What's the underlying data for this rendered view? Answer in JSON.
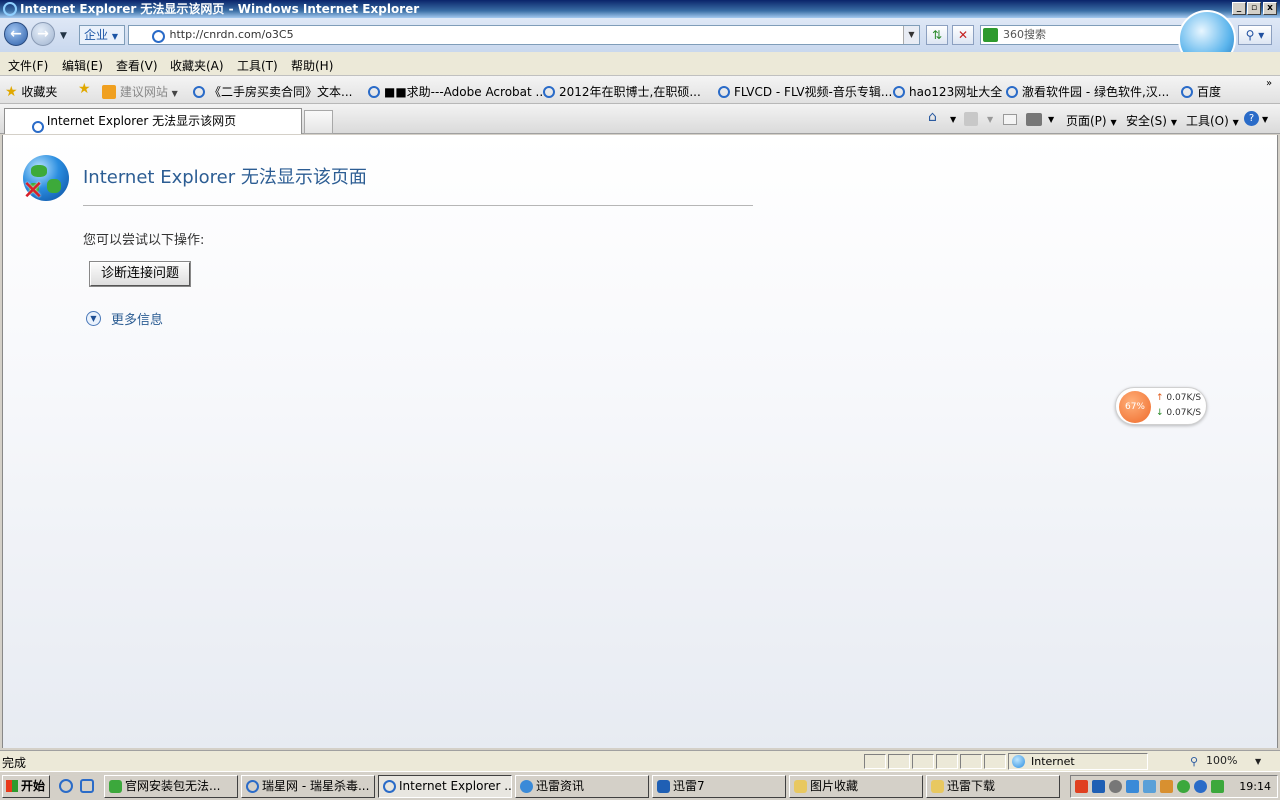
{
  "window": {
    "title": "Internet Explorer 无法显示该网页 - Windows Internet Explorer",
    "min": "_",
    "max": "▫",
    "close": "x"
  },
  "address": {
    "zone": "企业",
    "url": "http://cnrdn.com/o3C5",
    "search_placeholder": "360搜索"
  },
  "menu": [
    "文件(F)",
    "编辑(E)",
    "查看(V)",
    "收藏夹(A)",
    "工具(T)",
    "帮助(H)"
  ],
  "favorites": {
    "label": "收藏夹",
    "suggested": "建议网站",
    "items": [
      "《二手房买卖合同》文本...",
      "■■求助---Adobe Acrobat ...",
      "2012年在职博士,在职硕...",
      "FLVCD - FLV视频-音乐专辑...",
      "hao123网址大全",
      "澈看软件园 - 绿色软件,汉...",
      "百度"
    ]
  },
  "tab": {
    "title": "Internet Explorer 无法显示该网页"
  },
  "commands": {
    "page": "页面(P)",
    "safety": "安全(S)",
    "tools": "工具(O)"
  },
  "error": {
    "title": "Internet Explorer 无法显示该页面",
    "try_text": "您可以尝试以下操作:",
    "diagnose_button": "诊断连接问题",
    "more_info": "更多信息"
  },
  "speed_widget": {
    "percent": "67%",
    "up": "0.07K/S",
    "down": "0.07K/S"
  },
  "status": {
    "text": "完成",
    "zone": "Internet",
    "zoom": "100%"
  },
  "taskbar": {
    "start": "开始",
    "items": [
      "官网安装包无法...",
      "瑞星网 - 瑞星杀毒...",
      "Internet Explorer ...",
      "迅雷资讯",
      "迅雷7",
      "图片收藏",
      "迅雷下载"
    ],
    "clock": "19:14"
  }
}
